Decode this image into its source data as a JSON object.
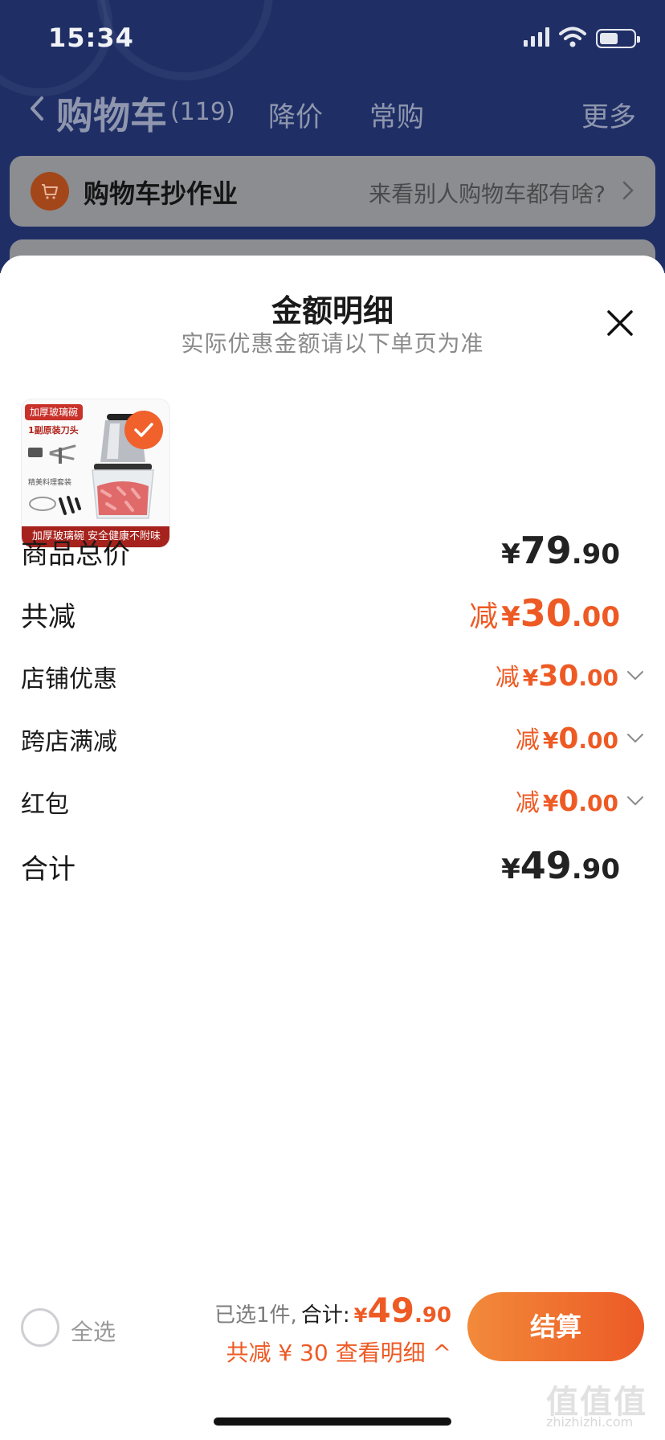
{
  "status_bar": {
    "time": "15:34"
  },
  "nav": {
    "title": "购物车",
    "count": "(119)",
    "tabs": [
      "降价",
      "常购"
    ],
    "more": "更多"
  },
  "banner": {
    "title": "购物车抄作业",
    "subtitle": "来看别人购物车都有啥?"
  },
  "sheet": {
    "title": "金额明细",
    "subtitle": "实际优惠金额请以下单页为准",
    "product": {
      "tag": "加厚玻璃碗",
      "line1": "1副原装刀头",
      "line2": "精美料理套装",
      "bottom": "加厚玻璃碗 安全健康不附味",
      "selected": true
    },
    "rows": {
      "total_price": {
        "label": "商品总价",
        "yen": "¥",
        "int": "79",
        "dec": ".90"
      },
      "total_discount": {
        "label": "共减",
        "prefix": "减",
        "yen": "¥",
        "int": "30",
        "dec": ".00"
      },
      "shop_discount": {
        "label": "店铺优惠",
        "prefix": "减",
        "yen": "¥",
        "int": "30",
        "dec": ".00"
      },
      "cross_shop": {
        "label": "跨店满减",
        "prefix": "减",
        "yen": "¥",
        "int": "0",
        "dec": ".00"
      },
      "red_packet": {
        "label": "红包",
        "prefix": "减",
        "yen": "¥",
        "int": "0",
        "dec": ".00"
      },
      "grand_total": {
        "label": "合计",
        "yen": "¥",
        "int": "49",
        "dec": ".90"
      }
    }
  },
  "bottom_bar": {
    "select_all": "全选",
    "selected_count": "已选1件,",
    "total_label": "合计:",
    "total_yen": "¥",
    "total_int": "49",
    "total_dec": ".90",
    "detail_link": "共减 ¥ 30 查看明细 ^",
    "checkout": "结算"
  },
  "watermark": {
    "main": "值值值",
    "sub": "zhizhizhi.com"
  },
  "colors": {
    "accent": "#ee5a24",
    "nav_bg": "#1f2f66",
    "checkout_start": "#f28a3a",
    "checkout_end": "#ec5a26"
  }
}
